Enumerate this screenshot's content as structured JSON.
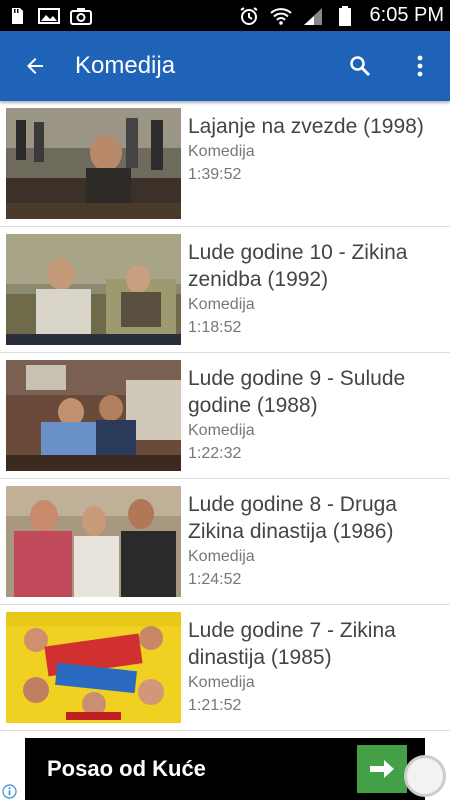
{
  "status_bar": {
    "time": "6:05 PM",
    "icons": [
      "sd-card-icon",
      "image-icon",
      "camera-icon",
      "alarm-icon",
      "wifi-icon",
      "signal-icon",
      "battery-icon"
    ]
  },
  "app_bar": {
    "title": "Komedija",
    "color": "#1e63b8",
    "icons": [
      "back-arrow-icon",
      "search-icon",
      "more-vert-icon"
    ]
  },
  "list": {
    "items": [
      {
        "title": "Lajanje na zvezde (1998)",
        "category": "Komedija",
        "duration": "1:39:52"
      },
      {
        "title": "Lude godine 10 - Zikina zenidba (1992)",
        "category": "Komedija",
        "duration": "1:18:52"
      },
      {
        "title": "Lude godine 9 - Sulude godine (1988)",
        "category": "Komedija",
        "duration": "1:22:32"
      },
      {
        "title": "Lude godine 8 - Druga Zikina dinastija (1986)",
        "category": "Komedija",
        "duration": "1:24:52"
      },
      {
        "title": "Lude godine 7 - Zikina dinastija (1985)",
        "category": "Komedija",
        "duration": "1:21:52"
      }
    ]
  },
  "ad": {
    "text": "Posao od Kuće",
    "button_color": "#43a047",
    "icons": [
      "arrow-right-icon",
      "info-icon"
    ]
  }
}
